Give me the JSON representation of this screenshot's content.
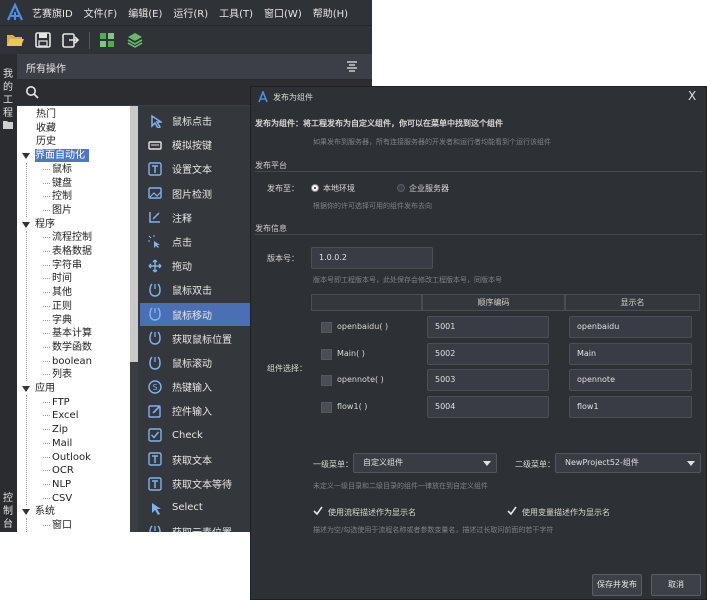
{
  "menubar": {
    "items": [
      "艺赛旗ID",
      "文件(F)",
      "编辑(E)",
      "运行(R)",
      "工具(T)",
      "窗口(W)",
      "帮助(H)"
    ]
  },
  "toolbar": {
    "icons": [
      "open-folder-icon",
      "save-icon",
      "export-icon",
      "publish-component-icon",
      "stack-icon"
    ]
  },
  "left_strip": {
    "top_label": [
      "我",
      "的",
      "工",
      "程"
    ],
    "bottom_label": [
      "控",
      "制",
      "台"
    ]
  },
  "panel": {
    "title": "所有操作"
  },
  "tree": {
    "nodes": [
      {
        "label": "热门",
        "level": 1
      },
      {
        "label": "收藏",
        "level": 1
      },
      {
        "label": "历史",
        "level": 1
      },
      {
        "label": "界面自动化",
        "level": 0,
        "expanded": true,
        "selected": true
      },
      {
        "label": "鼠标",
        "level": 2
      },
      {
        "label": "键盘",
        "level": 2
      },
      {
        "label": "控制",
        "level": 2
      },
      {
        "label": "图片",
        "level": 2
      },
      {
        "label": "程序",
        "level": 0,
        "expanded": true
      },
      {
        "label": "流程控制",
        "level": 2
      },
      {
        "label": "表格数据",
        "level": 2
      },
      {
        "label": "字符串",
        "level": 2
      },
      {
        "label": "时间",
        "level": 2
      },
      {
        "label": "其他",
        "level": 2
      },
      {
        "label": "正则",
        "level": 2
      },
      {
        "label": "字典",
        "level": 2
      },
      {
        "label": "基本计算",
        "level": 2
      },
      {
        "label": "数学函数",
        "level": 2
      },
      {
        "label": "boolean",
        "level": 2
      },
      {
        "label": "列表",
        "level": 2
      },
      {
        "label": "应用",
        "level": 0,
        "expanded": true
      },
      {
        "label": "FTP",
        "level": 2
      },
      {
        "label": "Excel",
        "level": 2
      },
      {
        "label": "Zip",
        "level": 2
      },
      {
        "label": "Mail",
        "level": 2
      },
      {
        "label": "Outlook",
        "level": 2
      },
      {
        "label": "OCR",
        "level": 2
      },
      {
        "label": "NLP",
        "level": 2
      },
      {
        "label": "CSV",
        "level": 2
      },
      {
        "label": "系统",
        "level": 0,
        "expanded": true
      },
      {
        "label": "窗口",
        "level": 2
      }
    ]
  },
  "actions": {
    "items": [
      {
        "label": "鼠标点击",
        "icon": "mouse-click-icon"
      },
      {
        "label": "模拟按键",
        "icon": "keyboard-icon"
      },
      {
        "label": "设置文本",
        "icon": "set-text-icon"
      },
      {
        "label": "图片检测",
        "icon": "image-detect-icon"
      },
      {
        "label": "注释",
        "icon": "comment-icon"
      },
      {
        "label": "点击",
        "icon": "click-icon"
      },
      {
        "label": "拖动",
        "icon": "drag-icon"
      },
      {
        "label": "鼠标双击",
        "icon": "mouse-doubleclick-icon"
      },
      {
        "label": "鼠标移动",
        "icon": "mouse-move-icon",
        "selected": true
      },
      {
        "label": "获取鼠标位置",
        "icon": "mouse-position-icon"
      },
      {
        "label": "鼠标滚动",
        "icon": "mouse-scroll-icon"
      },
      {
        "label": "热键输入",
        "icon": "hotkey-icon"
      },
      {
        "label": "控件输入",
        "icon": "control-input-icon"
      },
      {
        "label": "Check",
        "icon": "checkbox-icon"
      },
      {
        "label": "获取文本",
        "icon": "get-text-icon"
      },
      {
        "label": "获取文本等待",
        "icon": "get-text-wait-icon"
      },
      {
        "label": "Select",
        "icon": "select-icon"
      },
      {
        "label": "获取元素位置",
        "icon": "element-position-icon"
      }
    ]
  },
  "dialog": {
    "title": "发布为组件",
    "close": "X",
    "intro": "发布为组件：将工程发布为自定义组件，你可以在菜单中找到这个组件",
    "intro_hint": "如果发布到服务器，所有连接服务器的开发者和运行者均能看到个运行该组件",
    "platform_section": "发布平台",
    "publish_to_label": "发布至：",
    "radio_local": "本地环境",
    "radio_server": "企业服务器",
    "platform_hint": "根据你的许可选择可用的组件发布去向",
    "info_section": "发布信息",
    "version_label": "版本号：",
    "version_value": "1.0.0.2",
    "version_hint": "版本号即工程版本号，此处保存会修改工程版本号，同版本号",
    "component_select_label": "组件选择：",
    "table": {
      "col_order": "顺序编码",
      "col_display": "显示名",
      "rows": [
        {
          "name": "openbaidu( )",
          "code": "5001",
          "display": "openbaidu"
        },
        {
          "name": "Main( )",
          "code": "5002",
          "display": "Main"
        },
        {
          "name": "opennote( )",
          "code": "5003",
          "display": "opennote"
        },
        {
          "name": "flow1( )",
          "code": "5004",
          "display": "flow1"
        }
      ]
    },
    "menu1_label": "一级菜单：",
    "menu1_value": "自定义组件",
    "menu2_label": "二级菜单：",
    "menu2_value": "NewProject52-组件",
    "menu_hint": "未定义一级目录和二级目录的组件一律放在到自定义组件",
    "check_flow_desc": "使用流程描述作为显示名",
    "check_var_desc": "使用变量描述作为显示名",
    "display_hint": "描述为空/勾选使用于流程名称或者参数变量名，描述过长取问前面的若干字符",
    "save_button": "保存并发布",
    "cancel_button": "取消"
  },
  "colors": {
    "accent": "#4a6fb5",
    "radio_checked": "#ffffff",
    "dialog_bg": "#2d3035"
  }
}
